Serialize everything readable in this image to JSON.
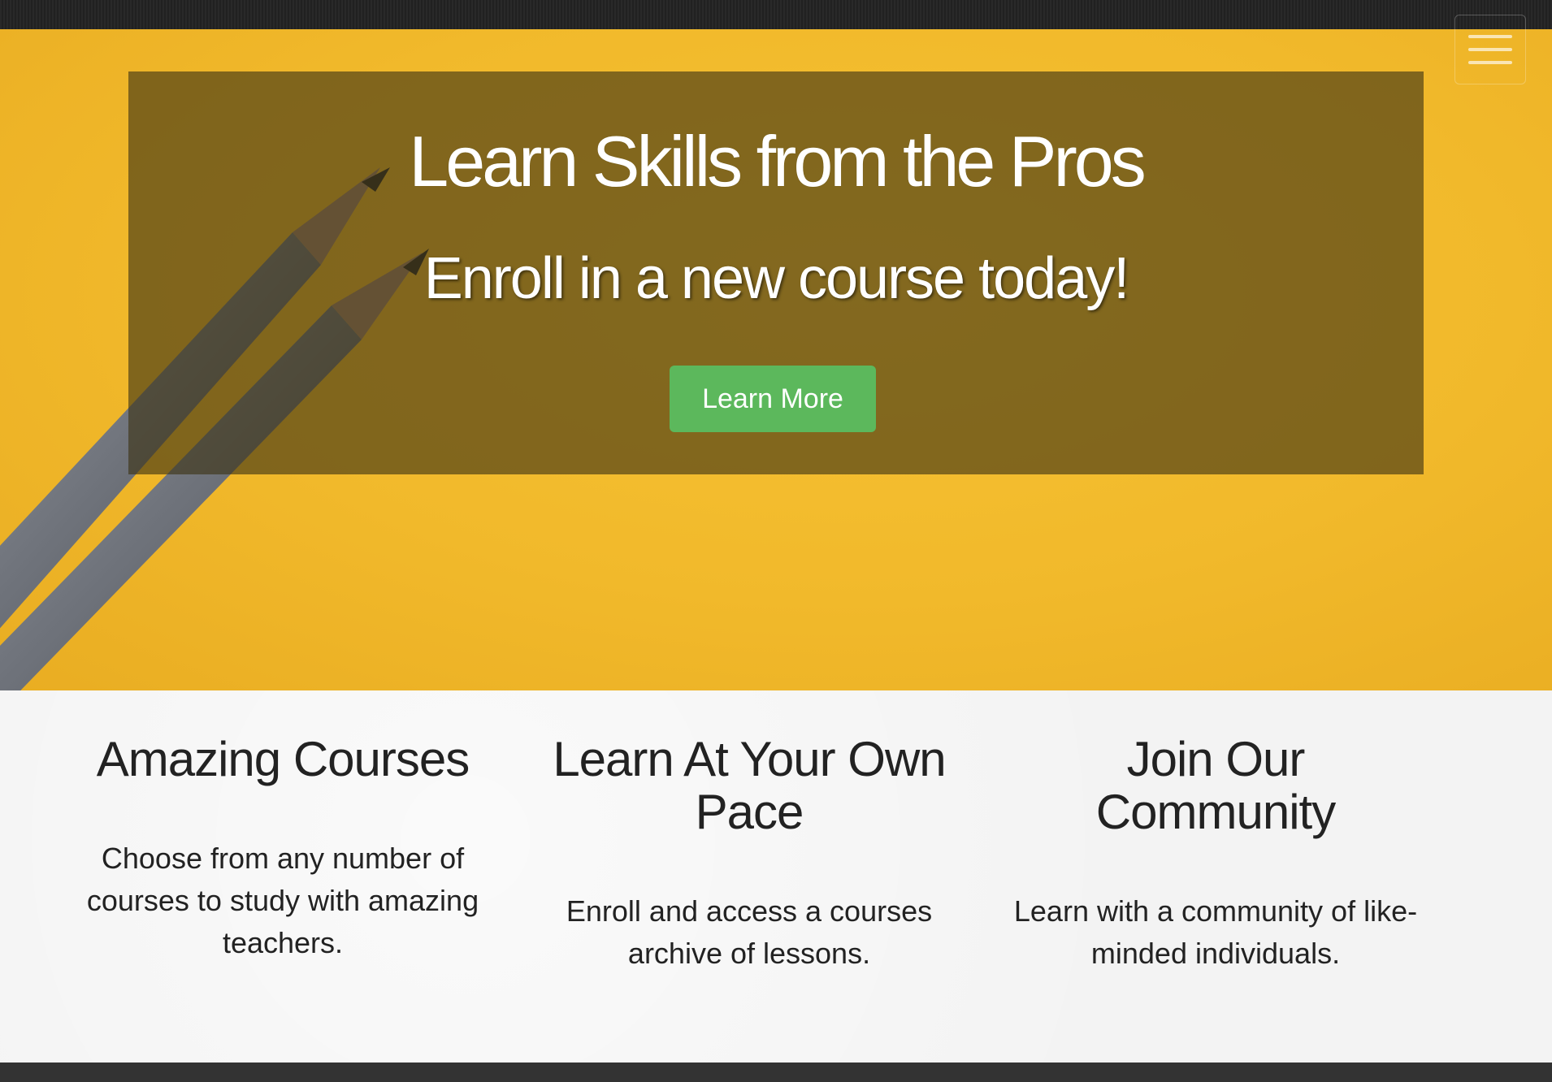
{
  "nav": {
    "menu_icon": "hamburger-icon"
  },
  "hero": {
    "title": "Learn Skills from the Pros",
    "subtitle": "Enroll in a new course today!",
    "button_label": "Learn More"
  },
  "features": [
    {
      "heading": "Amazing Courses",
      "text": "Choose from any number of courses to study with amazing teachers."
    },
    {
      "heading": "Learn At Your Own Pace",
      "text": "Enroll and access a courses archive of lessons."
    },
    {
      "heading": "Join Our Community",
      "text": "Learn with a community of like-minded individuals."
    }
  ],
  "colors": {
    "hero_background": "#f1b92b",
    "overlay": "#3c3214",
    "button": "#5cb85c",
    "topbar": "#222222",
    "footer": "#333333"
  }
}
